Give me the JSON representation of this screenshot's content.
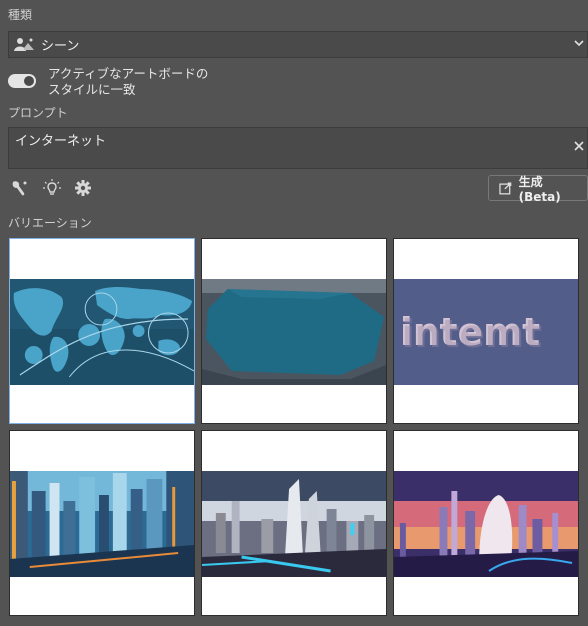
{
  "type_section": {
    "label": "種類",
    "selected": "シーン",
    "icon": "person-landscape-icon"
  },
  "toggle": {
    "text_line1": "アクティブなアートボードの",
    "text_line2": "スタイルに一致",
    "on": true
  },
  "prompt_section": {
    "label": "プロンプト",
    "value": "インターネット"
  },
  "tools": [
    "style-brush-icon",
    "lightbulb-icon",
    "settings-gear-icon"
  ],
  "generate_button": {
    "label": "生成 (Beta)",
    "icon": "generate-icon"
  },
  "variations": {
    "label": "バリエーション",
    "items": [
      {
        "description": "world map network",
        "selected": true,
        "color": "#2f6f8c"
      },
      {
        "description": "teal polygon",
        "selected": false,
        "color": "#1f6880"
      },
      {
        "description": "internet text",
        "selected": false,
        "color": "#525c8c"
      },
      {
        "description": "futuristic city blue",
        "selected": false,
        "color": "#2a4e6d"
      },
      {
        "description": "futuristic city dusk",
        "selected": false,
        "color": "#8d96a8"
      },
      {
        "description": "futuristic city sunset",
        "selected": false,
        "color": "#5a3c7c"
      }
    ]
  }
}
